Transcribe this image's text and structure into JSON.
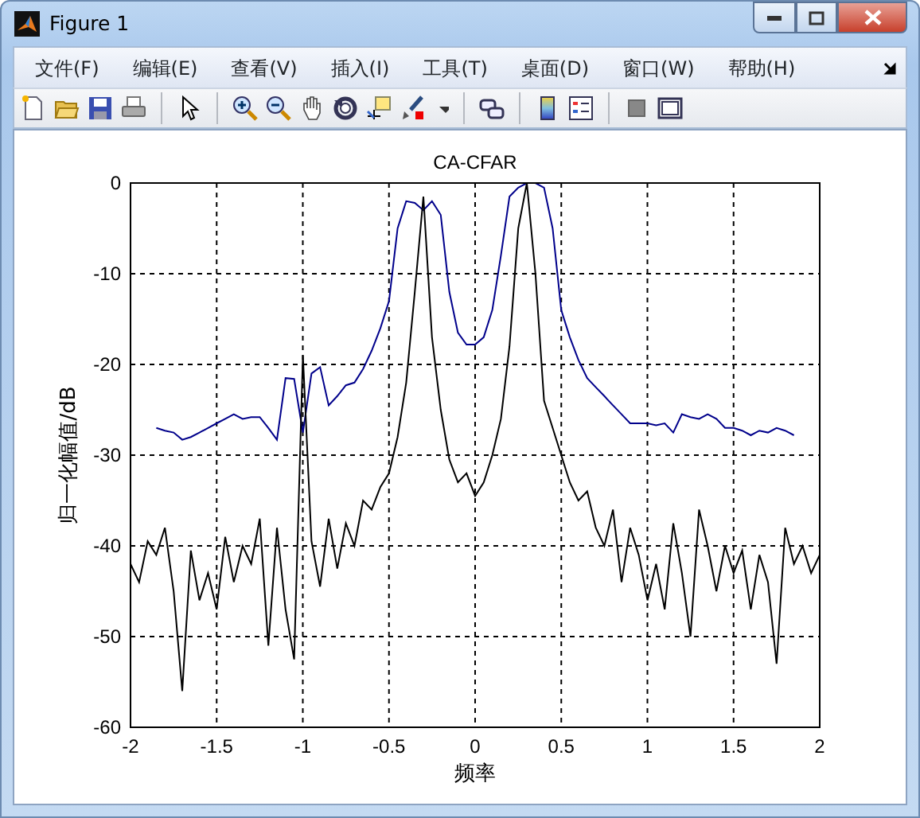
{
  "window": {
    "title": "Figure 1"
  },
  "menu": [
    "文件(F)",
    "编辑(E)",
    "查看(V)",
    "插入(I)",
    "工具(T)",
    "桌面(D)",
    "窗口(W)",
    "帮助(H)"
  ],
  "figure": {
    "chart_data": {
      "type": "line",
      "grid": true,
      "title": "CA-CFAR",
      "xlabel": "频率",
      "ylabel": "归一化幅值/dB",
      "xlim": [
        -2,
        2
      ],
      "ylim": [
        -60,
        0
      ],
      "xticks": [
        -2,
        -1.5,
        -1,
        -0.5,
        0,
        0.5,
        1,
        1.5,
        2
      ],
      "yticks": [
        0,
        -10,
        -20,
        -30,
        -40,
        -50,
        -60
      ],
      "x": [
        -2,
        -1.95,
        -1.9,
        -1.85,
        -1.8,
        -1.75,
        -1.7,
        -1.65,
        -1.6,
        -1.55,
        -1.5,
        -1.45,
        -1.4,
        -1.35,
        -1.3,
        -1.25,
        -1.2,
        -1.15,
        -1.1,
        -1.05,
        -1,
        -0.95,
        -0.9,
        -0.85,
        -0.8,
        -0.75,
        -0.7,
        -0.65,
        -0.6,
        -0.55,
        -0.5,
        -0.45,
        -0.4,
        -0.35,
        -0.3,
        -0.25,
        -0.2,
        -0.15,
        -0.1,
        -0.05,
        0,
        0.05,
        0.1,
        0.15,
        0.2,
        0.25,
        0.3,
        0.35,
        0.4,
        0.45,
        0.5,
        0.55,
        0.6,
        0.65,
        0.7,
        0.75,
        0.8,
        0.85,
        0.9,
        0.95,
        1,
        1.05,
        1.1,
        1.15,
        1.2,
        1.25,
        1.3,
        1.35,
        1.4,
        1.45,
        1.5,
        1.55,
        1.6,
        1.65,
        1.7,
        1.75,
        1.8,
        1.85,
        1.9,
        1.95,
        2
      ],
      "series": [
        {
          "color": "#00008b",
          "values": [
            null,
            null,
            null,
            -27,
            -27.3,
            -27.5,
            -28.3,
            -28,
            -27.5,
            -27,
            -26.5,
            -26,
            -25.5,
            -26,
            -25.8,
            -25.8,
            -27,
            -28.3,
            -21.5,
            -21.6,
            -27.5,
            -21,
            -20.3,
            -24.5,
            -23.5,
            -22.3,
            -22,
            -20.5,
            -18.5,
            -16,
            -13,
            -5,
            -2,
            -2.2,
            -3,
            -2,
            -3.5,
            -12,
            -16.5,
            -17.8,
            -17.8,
            -17,
            -14,
            -8,
            -1.5,
            -0.5,
            0,
            0,
            -0.5,
            -5,
            -14,
            -17,
            -19.5,
            -21.5,
            -22.5,
            -23.5,
            -24.5,
            -25.5,
            -26.5,
            -26.5,
            -26.5,
            -26.7,
            -26.5,
            -27.5,
            -25.5,
            -25.8,
            -26,
            -25.5,
            -26,
            -27,
            -27,
            -27.3,
            -27.8,
            -27.3,
            -27.5,
            -27,
            -27.3,
            -27.8,
            null,
            null,
            null
          ]
        },
        {
          "color": "#000000",
          "values": [
            -42,
            -44,
            -39.5,
            -41,
            -38,
            -45,
            -56,
            -40.5,
            -46,
            -43,
            -47,
            -39,
            -44,
            -40,
            -42,
            -37,
            -51,
            -38,
            -47,
            -52.5,
            -19,
            -39.5,
            -44.5,
            -37,
            -42.5,
            -37.5,
            -40,
            -35,
            -36,
            -33.5,
            -32,
            -28,
            -22,
            -12,
            -1.5,
            -17,
            -25,
            -30.5,
            -33,
            -32,
            -34.5,
            -33,
            -30,
            -26,
            -18,
            -5,
            0,
            -10,
            -24,
            -27,
            -30,
            -33,
            -35,
            -34,
            -38,
            -40,
            -36,
            -44,
            -38,
            -41,
            -46,
            -42,
            -47,
            -37.5,
            -43,
            -50,
            -36,
            -40,
            -45,
            -40,
            -43,
            -40.5,
            -47,
            -41,
            -44,
            -53,
            -38,
            -42,
            -40,
            -43,
            -41
          ]
        }
      ]
    }
  }
}
